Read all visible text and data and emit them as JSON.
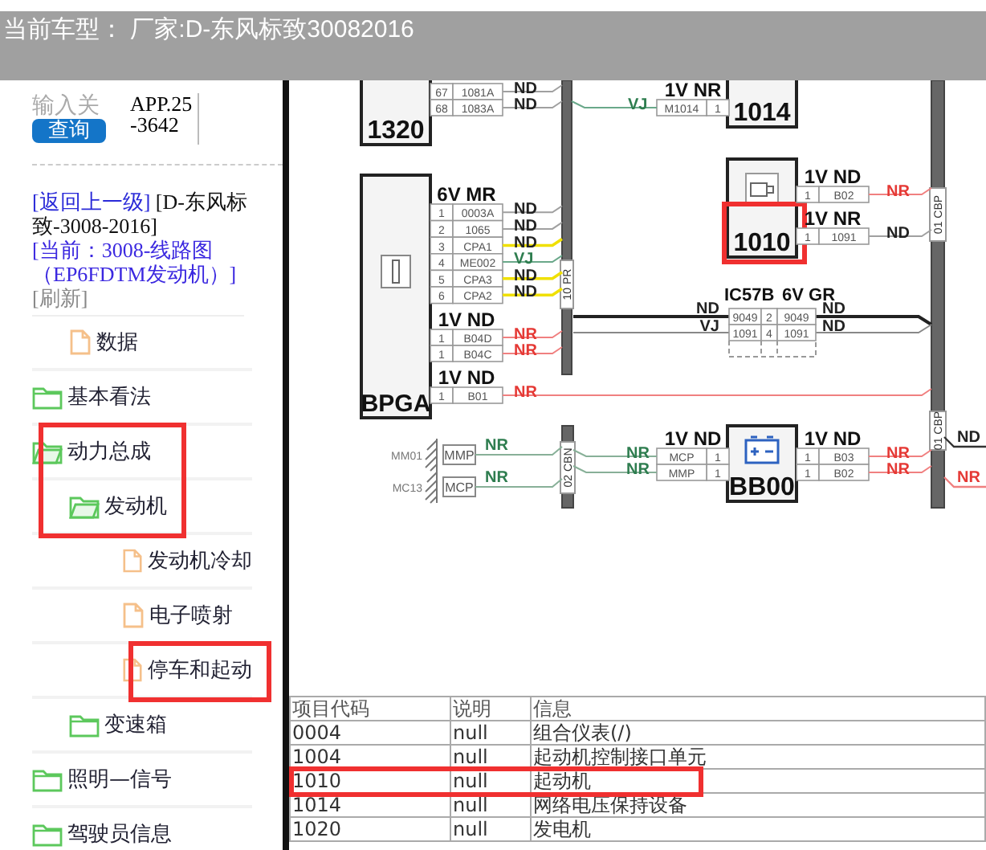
{
  "header": {
    "title": "当前车型：  厂家:D-东风标致30082016"
  },
  "search": {
    "placeholder": "输入关",
    "button": "查询",
    "version": "APP.25-3642"
  },
  "breadcrumb": {
    "back_link": "[返回上一级]",
    "vehicle": "[D-东风标致-3008-2016]",
    "current_link": "[当前：3008-线路图（EP6FDTM发动机）]",
    "refresh": "[刷新]"
  },
  "continued_items": [
    {
      "label": "数据",
      "kind": "file",
      "highlighted": false
    }
  ],
  "tree": [
    {
      "label": "基本看法",
      "kind": "folder",
      "expanded": false,
      "highlighted": false
    },
    {
      "label": "动力总成",
      "kind": "folder",
      "expanded": true,
      "highlighted": true,
      "children": [
        {
          "label": "发动机",
          "kind": "folder",
          "expanded": true,
          "highlighted": true,
          "children": [
            {
              "label": "发动机冷却",
              "kind": "file",
              "highlighted": false
            },
            {
              "label": "电子喷射",
              "kind": "file",
              "highlighted": false
            },
            {
              "label": "停车和起动",
              "kind": "file",
              "highlighted": true
            }
          ]
        },
        {
          "label": "变速箱",
          "kind": "folder",
          "expanded": false,
          "highlighted": false
        }
      ]
    },
    {
      "label": "照明—信号",
      "kind": "folder",
      "expanded": false,
      "highlighted": false
    },
    {
      "label": "驾驶员信息",
      "kind": "folder",
      "expanded": false,
      "highlighted": false
    }
  ],
  "diagram": {
    "modules": [
      {
        "label": "1320",
        "highlighted": false
      },
      {
        "label": "BPGA",
        "highlighted": false
      },
      {
        "label": "1014",
        "highlighted": false
      },
      {
        "label": "1010",
        "highlighted": true
      },
      {
        "label": "BB00",
        "highlighted": false
      }
    ],
    "connectors": [
      {
        "rows": [
          {
            "pin": "67",
            "code": "1081A",
            "wire": "ND",
            "color": "#a0a0a0"
          },
          {
            "pin": "68",
            "code": "1083A",
            "wire": "ND",
            "color": "#a0a0a0"
          }
        ]
      },
      {
        "header": "6V MR",
        "rows": [
          {
            "pin": "1",
            "code": "0003A",
            "wire": "ND",
            "color": "#a0a0a0"
          },
          {
            "pin": "2",
            "code": "1065",
            "wire": "ND",
            "color": "#a0a0a0"
          },
          {
            "pin": "3",
            "code": "CPA1",
            "wire": "ND",
            "color": "#f0e000"
          },
          {
            "pin": "4",
            "code": "ME002",
            "wire": "VJ",
            "color": "#6aa88a"
          },
          {
            "pin": "5",
            "code": "CPA3",
            "wire": "ND",
            "color": "#f0e000"
          },
          {
            "pin": "6",
            "code": "CPA2",
            "wire": "ND",
            "color": "#f0e000"
          }
        ]
      },
      {
        "header": "1V ND",
        "rows": [
          {
            "pin": "1",
            "code": "B04D",
            "wire": "NR",
            "color": "#f08080"
          },
          {
            "pin": "1",
            "code": "B04C",
            "wire": "NR",
            "color": "#f08080"
          }
        ]
      },
      {
        "header": "1V ND",
        "rows": [
          {
            "pin": "1",
            "code": "B01",
            "wire": "NR",
            "color": "#f08080"
          }
        ]
      },
      {
        "header": "1V NR",
        "rows": [
          {
            "pin": "1",
            "code": "M1014",
            "wire": "VJ",
            "color": "#6aa88a"
          }
        ]
      },
      {
        "header": "1V ND",
        "rows": [
          {
            "pin": "1",
            "code": "B02",
            "wire": "NR",
            "color": "#f08080"
          }
        ]
      },
      {
        "header": "1V NR",
        "rows": [
          {
            "pin": "1",
            "code": "1091",
            "wire": "ND",
            "color": "#a0a0a0"
          }
        ]
      },
      {
        "header": "1V ND",
        "rows": [
          {
            "pin": "1",
            "code": "MCP",
            "wire": "NR",
            "color": "#88b098"
          },
          {
            "pin": "1",
            "code": "MMP",
            "wire": "NR",
            "color": "#88b098"
          }
        ]
      },
      {
        "header": "1V ND",
        "rows": [
          {
            "pin": "1",
            "code": "B03",
            "wire": "NR",
            "color": "#f08080"
          },
          {
            "pin": "1",
            "code": "B02",
            "wire": "NR",
            "color": "#f08080"
          }
        ]
      }
    ],
    "inline_connector": {
      "name": "IC57B",
      "header": "6V GR",
      "rows": [
        {
          "code_a": "9049",
          "pin": "2",
          "code_b": "9049",
          "wire_in": "ND",
          "wire_out": "ND"
        },
        {
          "code_a": "1091",
          "pin": "4",
          "code_b": "1091",
          "wire_in": "VJ",
          "wire_out": "ND"
        }
      ]
    },
    "buses": [
      {
        "label": "10 PR"
      },
      {
        "label": "01 CBP"
      },
      {
        "label": "01 CBP"
      },
      {
        "label": "02 CBN"
      }
    ],
    "grounds": [
      {
        "label": "MM01",
        "plug": "MMP",
        "wire": "NR"
      },
      {
        "label": "MC13",
        "plug": "MCP",
        "wire": "NR"
      }
    ],
    "offpage_wires": [
      {
        "wire": "ND",
        "color": "#333333"
      },
      {
        "wire": "NR",
        "color": "#f08080"
      }
    ]
  },
  "table": {
    "columns": [
      "项目代码",
      "说明",
      "信息"
    ],
    "rows": [
      {
        "cells": [
          "0004",
          "null",
          "组合仪表(/)"
        ],
        "highlighted": false
      },
      {
        "cells": [
          "1004",
          "null",
          "起动机控制接口单元"
        ],
        "highlighted": false
      },
      {
        "cells": [
          "1010",
          "null",
          "起动机"
        ],
        "highlighted": true
      },
      {
        "cells": [
          "1014",
          "null",
          "网络电压保持设备"
        ],
        "highlighted": false
      },
      {
        "cells": [
          "1020",
          "null",
          "发电机"
        ],
        "highlighted": false
      }
    ]
  }
}
